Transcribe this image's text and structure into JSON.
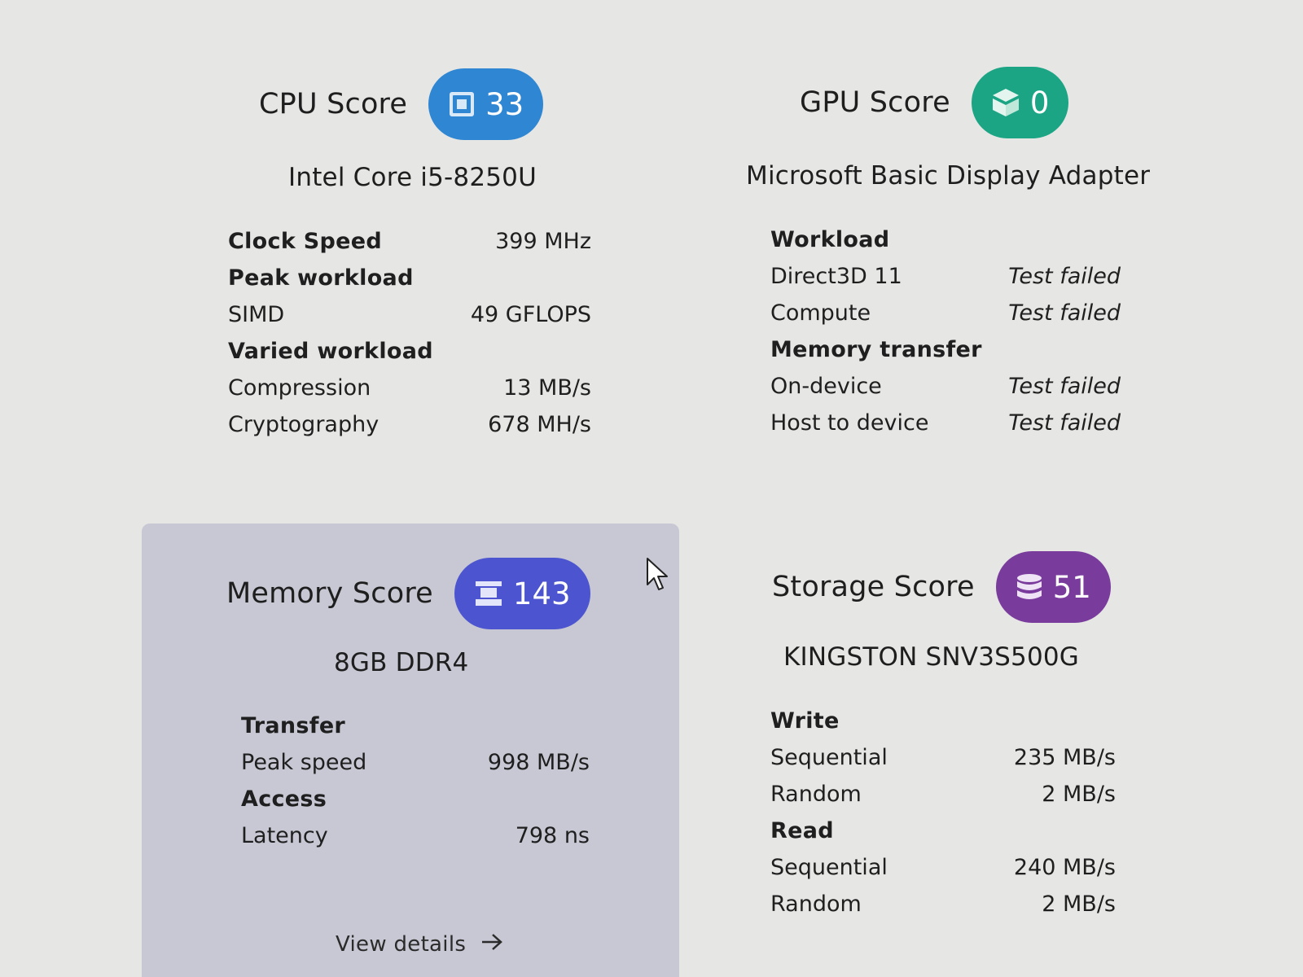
{
  "cpu": {
    "title": "CPU Score",
    "score": "33",
    "icon": "processor-icon",
    "color": "#2f86d3",
    "device": "Intel Core i5-8250U",
    "rows": [
      {
        "label": "Clock Speed",
        "value": "399 MHz",
        "section": true
      },
      {
        "label": "Peak workload",
        "value": "",
        "section": true
      },
      {
        "label": "SIMD",
        "value": "49 GFLOPS",
        "section": false
      },
      {
        "label": "Varied workload",
        "value": "",
        "section": true
      },
      {
        "label": "Compression",
        "value": "13 MB/s",
        "section": false
      },
      {
        "label": "Cryptography",
        "value": "678 MH/s",
        "section": false
      }
    ]
  },
  "gpu": {
    "title": "GPU Score",
    "score": "0",
    "icon": "cube-icon",
    "color": "#1ba584",
    "device": "Microsoft Basic Display Adapter",
    "rows": [
      {
        "label": "Workload",
        "value": "",
        "section": true
      },
      {
        "label": "Direct3D 11",
        "value": "Test failed",
        "section": false
      },
      {
        "label": "Compute",
        "value": "Test failed",
        "section": false
      },
      {
        "label": "Memory transfer",
        "value": "",
        "section": true
      },
      {
        "label": "On-device",
        "value": "Test failed",
        "section": false
      },
      {
        "label": "Host to device",
        "value": "Test failed",
        "section": false
      }
    ]
  },
  "memory": {
    "title": "Memory Score",
    "score": "143",
    "icon": "memory-module-icon",
    "color": "#4c55cf",
    "device": "8GB DDR4",
    "rows": [
      {
        "label": "Transfer",
        "value": "",
        "section": true
      },
      {
        "label": "Peak speed",
        "value": "998 MB/s",
        "section": false
      },
      {
        "label": "Access",
        "value": "",
        "section": true
      },
      {
        "label": "Latency",
        "value": "798 ns",
        "section": false
      }
    ],
    "link": "View details"
  },
  "storage": {
    "title": "Storage Score",
    "score": "51",
    "icon": "database-icon",
    "color": "#7a3c9c",
    "device": "KINGSTON SNV3S500G",
    "rows": [
      {
        "label": "Write",
        "value": "",
        "section": true
      },
      {
        "label": "Sequential",
        "value": "235 MB/s",
        "section": false
      },
      {
        "label": "Random",
        "value": "2 MB/s",
        "section": false
      },
      {
        "label": "Read",
        "value": "",
        "section": true
      },
      {
        "label": "Sequential",
        "value": "240 MB/s",
        "section": false
      },
      {
        "label": "Random",
        "value": "2 MB/s",
        "section": false
      }
    ]
  }
}
